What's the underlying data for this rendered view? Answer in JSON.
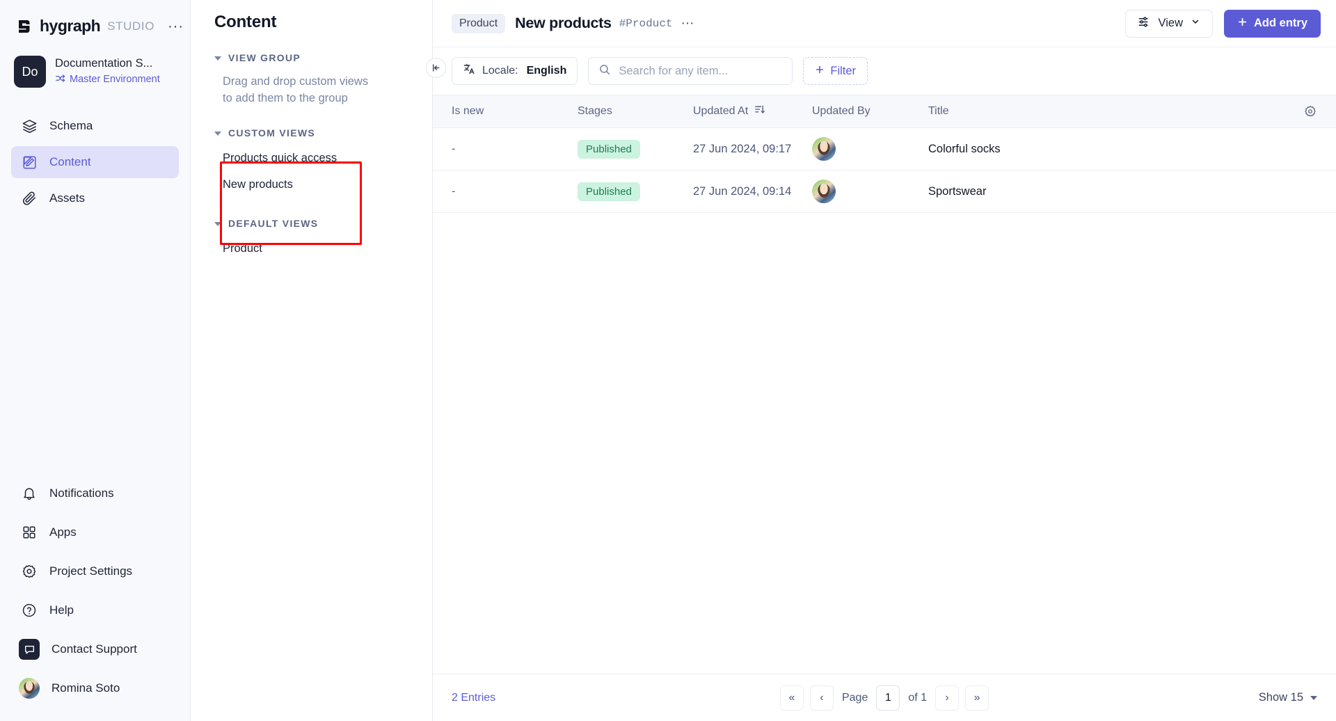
{
  "brand": {
    "name": "hygraph",
    "suffix": "STUDIO",
    "more_icon": "···",
    "logo_icon": "hygraph-logo-icon"
  },
  "project": {
    "avatar_initials": "Do",
    "name": "Documentation S...",
    "environment": "Master Environment",
    "environment_icon": "branch-icon"
  },
  "sidebar": {
    "main_items": [
      {
        "label": "Schema",
        "icon": "layers-icon",
        "active": false
      },
      {
        "label": "Content",
        "icon": "pencil-square-icon",
        "active": true
      },
      {
        "label": "Assets",
        "icon": "paperclip-icon",
        "active": false
      }
    ],
    "bottom_items": [
      {
        "label": "Notifications",
        "icon": "bell-icon"
      },
      {
        "label": "Apps",
        "icon": "grid-squares-icon"
      },
      {
        "label": "Project Settings",
        "icon": "gear-icon"
      },
      {
        "label": "Help",
        "icon": "question-circle-icon"
      },
      {
        "label": "Contact Support",
        "icon": "chat-bubble-icon"
      },
      {
        "label": "Romina Soto",
        "icon": "user-avatar"
      }
    ]
  },
  "views_panel": {
    "title": "Content",
    "collapse_icon": "collapse-left-icon",
    "sections": [
      {
        "heading": "VIEW GROUP",
        "description": "Drag and drop custom views to add them to the group",
        "items": []
      },
      {
        "heading": "CUSTOM VIEWS",
        "description": "",
        "items": [
          "Products quick access",
          "New products"
        ],
        "highlighted": true
      },
      {
        "heading": "DEFAULT VIEWS",
        "description": "",
        "items": [
          "Product"
        ]
      }
    ]
  },
  "header": {
    "breadcrumb_pill": "Product",
    "title": "New products",
    "api_id": "#Product",
    "more_icon": "···",
    "view_button": "View",
    "view_icon": "sliders-icon",
    "view_caret": "chevron-down-icon",
    "add_entry_button": "Add entry",
    "add_icon": "plus-icon"
  },
  "toolbar": {
    "locale_icon": "translate-icon",
    "locale_label": "Locale:",
    "locale_value": "English",
    "search_icon": "search-icon",
    "search_placeholder": "Search for any item...",
    "search_value": "",
    "filter_label": "Filter",
    "filter_icon": "plus-icon"
  },
  "table": {
    "columns": [
      {
        "label": "Is new",
        "sort_icon": ""
      },
      {
        "label": "Stages",
        "sort_icon": ""
      },
      {
        "label": "Updated At",
        "sort_icon": "sort-descending-icon"
      },
      {
        "label": "Updated By",
        "sort_icon": ""
      },
      {
        "label": "Title",
        "sort_icon": ""
      }
    ],
    "settings_icon": "gear-icon",
    "rows": [
      {
        "is_new": "-",
        "stage": "Published",
        "updated_at": "27 Jun 2024, 09:17",
        "updated_by_avatar": "user-avatar",
        "title": "Colorful socks"
      },
      {
        "is_new": "-",
        "stage": "Published",
        "updated_at": "27 Jun 2024, 09:14",
        "updated_by_avatar": "user-avatar",
        "title": "Sportswear"
      }
    ]
  },
  "footer": {
    "entries_count": "2 Entries",
    "first_page_icon": "«",
    "prev_page_icon": "‹",
    "page_label": "Page",
    "page_value": "1",
    "of_label": "of 1",
    "next_page_icon": "›",
    "last_page_icon": "»",
    "show_label": "Show 15"
  },
  "colors": {
    "accent": "#5b5bd6",
    "accent_bg": "#e0e0fb",
    "published_bg": "#ccf2e0",
    "published_text": "#1a7f52",
    "highlight_box": "#ff0000",
    "sidebar_bg": "#f8f9fc",
    "table_head_bg": "#f7f8fc"
  }
}
